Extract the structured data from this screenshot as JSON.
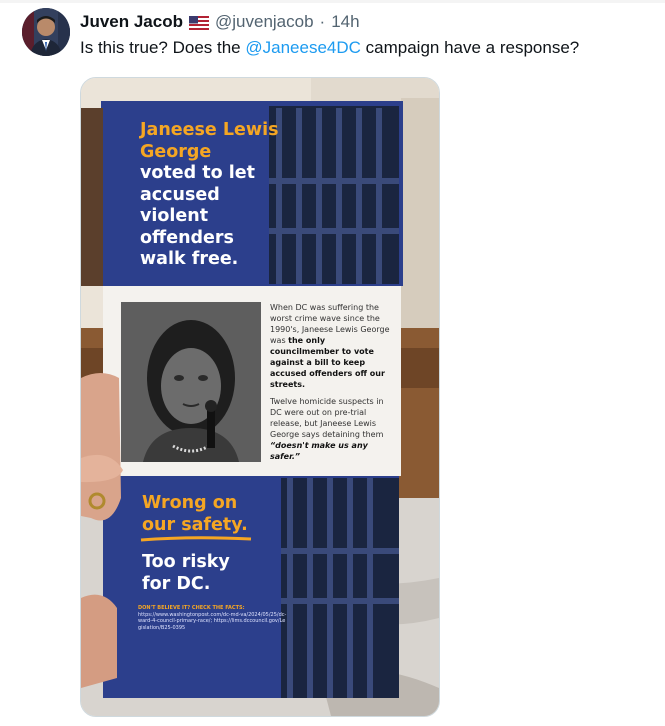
{
  "tweet": {
    "author_name": "Juven Jacob",
    "flag_icon": "us-flag-icon",
    "handle": "@juvenjacob",
    "separator": "·",
    "time": "14h",
    "text_before": "Is this true? Does the ",
    "mention": "@Janeese4DC",
    "text_after": " campaign have a response?"
  },
  "flyer": {
    "headline_name": "Janeese Lewis George",
    "headline_rest": "voted to let accused violent offenders walk free.",
    "body_p1_start": "When DC was suffering the worst crime wave since the 1990's, Janeese Lewis George was ",
    "body_p1_bold": "the only councilmember to vote against a bill to keep accused offenders off our streets.",
    "body_p2_start": "Twelve homicide suspects in DC were out on pre-trial release, but Janeese Lewis George says detaining them ",
    "body_p2_quote": "“doesn't make us any safer.”",
    "slogan_1": "Wrong on our safety.",
    "slogan_2": "Too risky for DC.",
    "facts_heading": "DON'T BELIEVE IT? CHECK THE FACTS:",
    "facts_links": "https://www.washingtonpost.com/dc-md-va/2024/05/25/dc-ward-4-council-primary-race/; https://lims.dccouncil.gov/Legislation/B25-0395"
  },
  "colors": {
    "accent_link": "#1d9bf0",
    "flyer_navy": "#2c3f8c",
    "flyer_orange": "#f5a623"
  }
}
